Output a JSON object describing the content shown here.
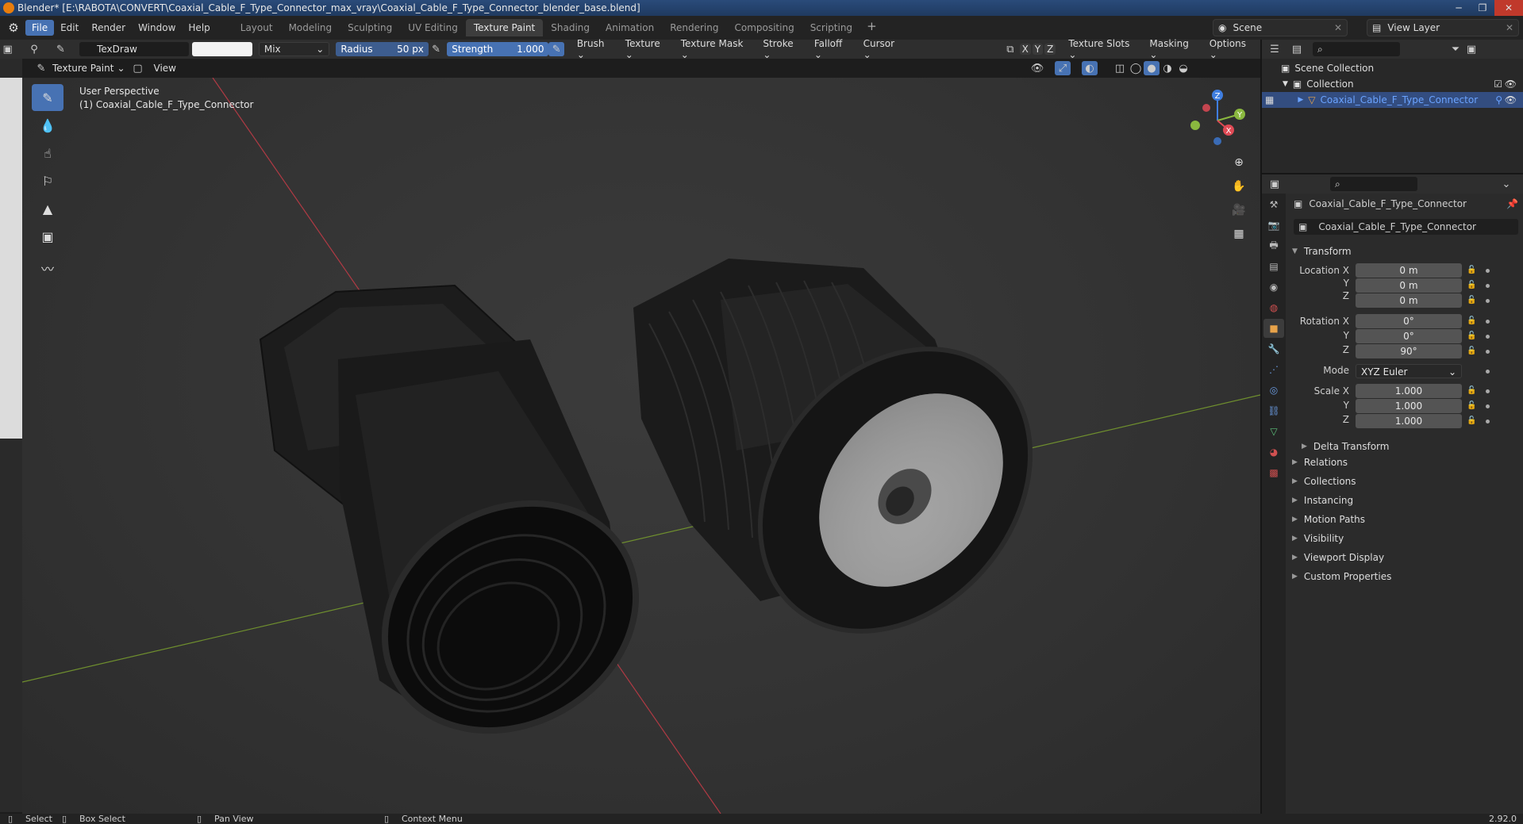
{
  "window": {
    "title": "Blender* [E:\\RABOTA\\CONVERT\\Coaxial_Cable_F_Type_Connector_max_vray\\Coaxial_Cable_F_Type_Connector_blender_base.blend]"
  },
  "menu": [
    "File",
    "Edit",
    "Render",
    "Window",
    "Help"
  ],
  "workspaces": [
    "Layout",
    "Modeling",
    "Sculpting",
    "UV Editing",
    "Texture Paint",
    "Shading",
    "Animation",
    "Rendering",
    "Compositing",
    "Scripting"
  ],
  "active_workspace": "Texture Paint",
  "scene": {
    "scene_name": "Scene",
    "view_layer": "View Layer"
  },
  "tool_header": {
    "brush_name": "TexDraw",
    "blend_mode": "Mix",
    "radius_label": "Radius",
    "radius_value": "50 px",
    "strength_label": "Strength",
    "strength_value": "1.000",
    "dropdowns": [
      "Brush",
      "Texture",
      "Texture Mask",
      "Stroke",
      "Falloff",
      "Cursor"
    ],
    "axes": [
      "X",
      "Y",
      "Z"
    ],
    "right_dropdowns": [
      "Texture Slots",
      "Masking",
      "Options"
    ]
  },
  "viewport_header": {
    "mode": "Texture Paint",
    "view_menu": "View"
  },
  "viewport": {
    "perspective": "User Perspective",
    "object_label": "(1) Coaxial_Cable_F_Type_Connector",
    "gizmo_axes": [
      "Z",
      "Y",
      "X"
    ]
  },
  "outliner": {
    "scene_collection": "Scene Collection",
    "collection": "Collection",
    "object": "Coaxial_Cable_F_Type_Connector"
  },
  "properties": {
    "object_name": "Coaxial_Cable_F_Type_Connector",
    "data_name": "Coaxial_Cable_F_Type_Connector",
    "transform_title": "Transform",
    "location_label": "Location X",
    "location": [
      "0 m",
      "0 m",
      "0 m"
    ],
    "rotation_label": "Rotation X",
    "rotation": [
      "0°",
      "0°",
      "90°"
    ],
    "mode_label": "Mode",
    "mode_value": "XYZ Euler",
    "scale_label": "Scale X",
    "scale": [
      "1.000",
      "1.000",
      "1.000"
    ],
    "axis_y": "Y",
    "axis_z": "Z",
    "delta_transform": "Delta Transform",
    "panels": [
      "Relations",
      "Collections",
      "Instancing",
      "Motion Paths",
      "Visibility",
      "Viewport Display",
      "Custom Properties"
    ]
  },
  "status": {
    "select": "Select",
    "box_select": "Box Select",
    "pan_view": "Pan View",
    "context_menu": "Context Menu",
    "version": "2.92.0"
  },
  "colors": {
    "accent": "#4772b3",
    "brand": "#e87d0d",
    "axis_x": "#e04a55",
    "axis_y": "#8ab83f",
    "axis_z": "#3f7ee0"
  }
}
